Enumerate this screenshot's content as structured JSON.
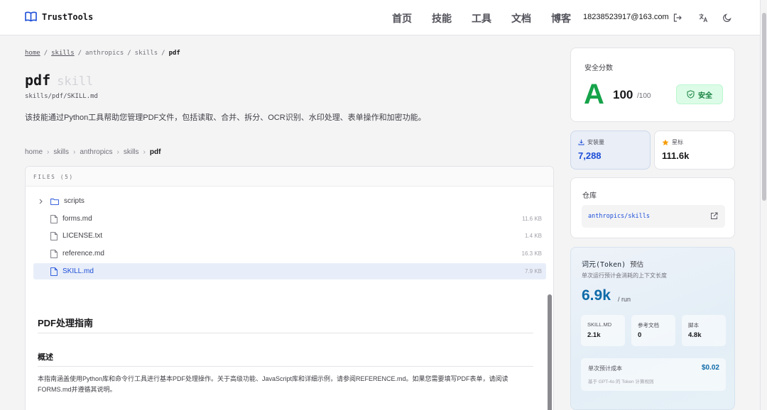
{
  "header": {
    "logo_text": "TrustTools",
    "nav": [
      "首页",
      "技能",
      "工具",
      "文档",
      "博客"
    ],
    "user_email": "18238523917@163.com"
  },
  "breadcrumb_top": [
    "home",
    "skills",
    "anthropics",
    "skills",
    "pdf"
  ],
  "page": {
    "title": "pdf",
    "title_suffix": "skill",
    "path": "skills/pdf/SKILL.md",
    "description": "该技能通过Python工具帮助您管理PDF文件，包括读取、合并、拆分、OCR识别、水印处理、表单操作和加密功能。"
  },
  "breadcrumb_files": [
    "home",
    "skills",
    "anthropics",
    "skills",
    "pdf"
  ],
  "files": {
    "header": "FILES (5)",
    "items": [
      {
        "name": "scripts",
        "type": "folder",
        "size": ""
      },
      {
        "name": "forms.md",
        "type": "file",
        "size": "11.6 KB"
      },
      {
        "name": "LICENSE.txt",
        "type": "file",
        "size": "1.4 KB"
      },
      {
        "name": "reference.md",
        "type": "file",
        "size": "16.3 KB"
      },
      {
        "name": "SKILL.md",
        "type": "file",
        "size": "7.9 KB",
        "selected": true
      }
    ]
  },
  "doc": {
    "h1": "PDF处理指南",
    "h2": "概述",
    "p": "本指南涵盖使用Python库和命令行工具进行基本PDF处理操作。关于高级功能、JavaScript库和详细示例，请参阅REFERENCE.md。如果您需要填写PDF表单，请阅读FORMS.md并遵循其说明。"
  },
  "security": {
    "label": "安全分数",
    "grade": "A",
    "score": "100",
    "max": "/100",
    "badge": "安全"
  },
  "stats": {
    "installs_label": "安装量",
    "installs": "7,288",
    "stars_label": "星标",
    "stars": "111.6k"
  },
  "repo": {
    "label": "仓库",
    "link": "anthropics/skills"
  },
  "tokens": {
    "title": "词元(Token)",
    "title_est": "预估",
    "subtitle": "单次运行预计会消耗的上下文长度",
    "value": "6.9k",
    "unit": "/ run",
    "breakdown": [
      {
        "label": "SKILL.MD",
        "value": "2.1k"
      },
      {
        "label": "参考文档",
        "value": "0"
      },
      {
        "label": "脚本",
        "value": "4.8k"
      }
    ],
    "cost_label": "单次预计成本",
    "cost_value": "$0.02",
    "cost_note": "基于 GPT-4o 的 Token 计算规则"
  },
  "colors": {
    "accent": "#1d4ed8",
    "grade": "#16a34a",
    "token": "#0e6ba8",
    "star": "#f59e0b"
  }
}
